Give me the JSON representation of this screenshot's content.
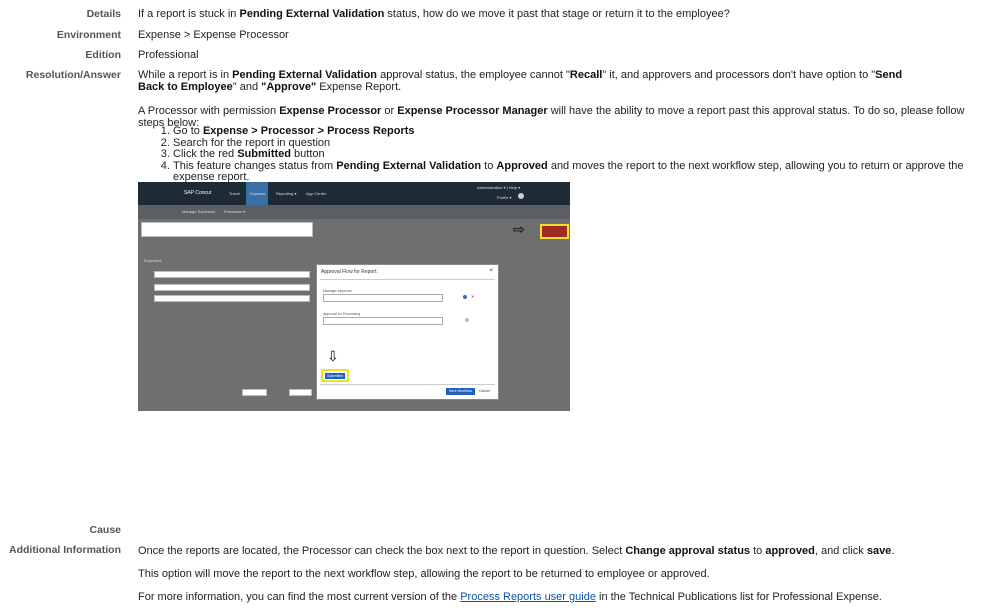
{
  "labels": {
    "details": "Details",
    "environment": "Environment",
    "edition": "Edition",
    "resolution": "Resolution/Answer",
    "cause": "Cause",
    "additional": "Additional Information"
  },
  "details": {
    "pre": "If a report is stuck in ",
    "bold": "Pending External Validation",
    "post": " status, how do we move it past that stage or return it to the employee?"
  },
  "environment": "Expense > Expense Processor",
  "edition": "Professional",
  "resolution": {
    "p1_a": "While a report is in ",
    "p1_b": "Pending External Validation",
    "p1_c": " approval status, the employee cannot \"",
    "p1_d": "Recall",
    "p1_e": "\" it, and approvers and processors don't have option to \"",
    "p1_f": "Send Back to Employee",
    "p1_g": "\" and ",
    "p1_h": "\"Approve\"",
    "p1_i": " Expense Report.",
    "p2_a": "A Processor with permission ",
    "p2_b": "Expense Processor",
    "p2_c": " or ",
    "p2_d": "Expense Processor Manager",
    "p2_e": " will have the ability to move a report past this approval status. To do so, please follow steps below:",
    "s1_a": "Go to ",
    "s1_b": "Expense > Processor > Process Reports",
    "s2": "Search for the report in question",
    "s3_a": "Click the red ",
    "s3_b": "Submitted",
    "s3_c": " button",
    "s4_a": "This feature changes status from ",
    "s4_b": "Pending External Validation",
    "s4_c": " to ",
    "s4_d": "Approved",
    "s4_e": " and moves the report to the next workflow step, allowing you to return or approve the expense report."
  },
  "screenshot": {
    "brand": "SAP Concur",
    "nav": [
      "Travel",
      "Expense",
      "Reporting ▾",
      "App Center"
    ],
    "admin": "Administration ▾  |  Help ▾",
    "profile": "Profile ▾",
    "subnav": [
      "Manage Expenses",
      "Processor ▾"
    ],
    "dialog_title": "Approval Flow for Report:",
    "manager_label": "Manager Approval",
    "processing_label": "Approval for Processing",
    "submitted": "Submitted",
    "save_workflow": "Save Workflow",
    "cancel": "Cancel",
    "expenses": "Expenses"
  },
  "additional": {
    "p1_a": "Once the reports are located, the Processor can check the box next to the report in question. Select ",
    "p1_b": "Change approval status",
    "p1_c": " to ",
    "p1_d": "approved",
    "p1_e": ", and click ",
    "p1_f": "save",
    "p1_g": ".",
    "p2": "This option will move the report to the next workflow step, allowing the report to be returned to employee or approved.",
    "p3_a": "For more information, you can find the most current version of the ",
    "p3_link": "Process Reports user guide",
    "p3_b": " in the Technical Publications list for Professional Expense."
  }
}
